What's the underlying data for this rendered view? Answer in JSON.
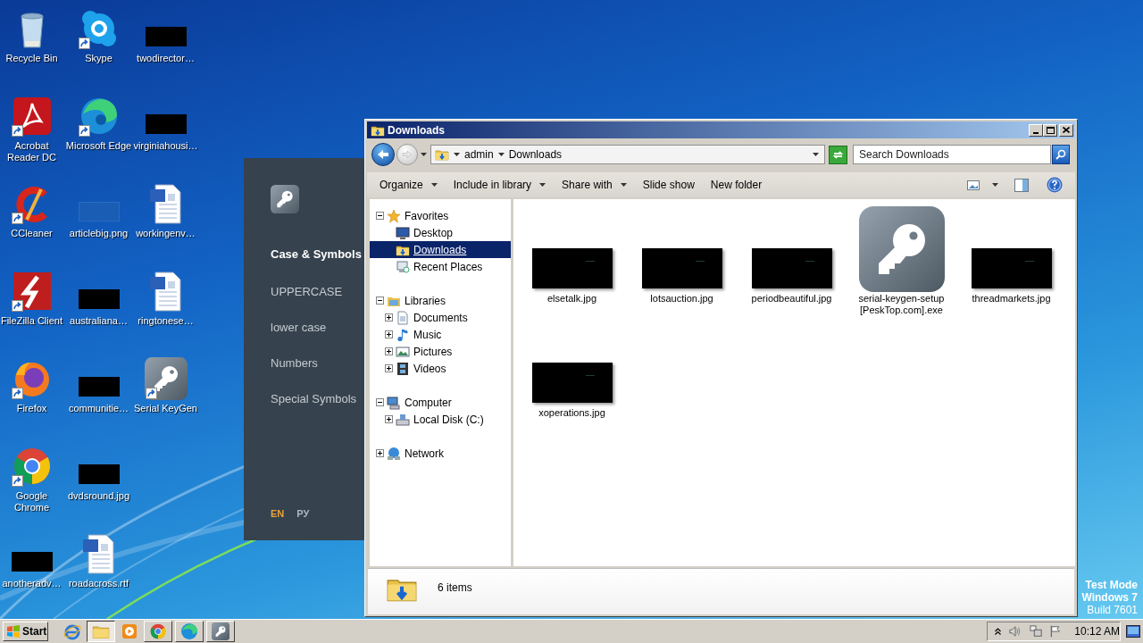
{
  "desktop_icons": [
    [
      {
        "label": "Recycle Bin",
        "kind": "recycle",
        "shortcut": false
      },
      {
        "label": "Skype",
        "kind": "chat",
        "shortcut": true
      },
      {
        "label": "twodirector…",
        "kind": "thumbnail",
        "shortcut": false
      }
    ],
    [
      {
        "label": "Acrobat Reader DC",
        "kind": "pdf",
        "shortcut": true
      },
      {
        "label": "Microsoft Edge",
        "kind": "edge",
        "shortcut": true
      },
      {
        "label": "virginiahousi…",
        "kind": "thumbnail",
        "shortcut": false
      }
    ],
    [
      {
        "label": "CCleaner",
        "kind": "cleaner",
        "shortcut": true
      },
      {
        "label": "articlebig.png",
        "kind": "blank",
        "shortcut": false
      },
      {
        "label": "workingenv…",
        "kind": "word",
        "shortcut": false
      }
    ],
    [
      {
        "label": "FileZilla Client",
        "kind": "ftp",
        "shortcut": true
      },
      {
        "label": "australiana…",
        "kind": "thumbnail",
        "shortcut": false
      },
      {
        "label": "ringtonese…",
        "kind": "word",
        "shortcut": false
      }
    ],
    [
      {
        "label": "Firefox",
        "kind": "fox",
        "shortcut": true
      },
      {
        "label": "communitie…",
        "kind": "thumbnail",
        "shortcut": false
      },
      {
        "label": "Serial KeyGen",
        "kind": "key",
        "shortcut": true
      }
    ],
    [
      {
        "label": "Google Chrome",
        "kind": "chrome",
        "shortcut": true
      },
      {
        "label": "dvdsround.jpg",
        "kind": "thumbnail",
        "shortcut": false
      }
    ],
    [
      {
        "label": "anotheradv…",
        "kind": "thumbnail",
        "shortcut": false
      },
      {
        "label": "roadacross.rtf",
        "kind": "word",
        "shortcut": false
      }
    ]
  ],
  "keygen_panel": {
    "heading": "Case & Symbols",
    "menu": [
      {
        "label": "UPPERCASE"
      },
      {
        "label": "lower case"
      },
      {
        "label": "Numbers"
      },
      {
        "label": "Special Symbols"
      }
    ],
    "languages": [
      {
        "label": "EN",
        "selected": true
      },
      {
        "label": "РУ",
        "selected": false
      }
    ]
  },
  "explorer": {
    "title": "Downloads",
    "address": [
      "admin",
      "Downloads"
    ],
    "search": {
      "placeholder": "Search Downloads"
    },
    "toolbar": [
      {
        "label": "Organize",
        "dropdown": true
      },
      {
        "label": "Include in library",
        "dropdown": true
      },
      {
        "label": "Share with",
        "dropdown": true
      },
      {
        "label": "Slide show",
        "dropdown": false
      },
      {
        "label": "New folder",
        "dropdown": false
      }
    ],
    "nav": [
      {
        "label": "Favorites",
        "kind": "star",
        "expanded": true,
        "selected": false,
        "children": [
          {
            "label": "Desktop",
            "kind": "desktop",
            "selected": false
          },
          {
            "label": "Downloads",
            "kind": "downloads",
            "selected": true
          },
          {
            "label": "Recent Places",
            "kind": "recent",
            "selected": false
          }
        ]
      },
      {
        "label": "Libraries",
        "kind": "library",
        "expanded": true,
        "selected": false,
        "children": [
          {
            "label": "Documents",
            "kind": "documents",
            "expanded": false,
            "selected": false
          },
          {
            "label": "Music",
            "kind": "music",
            "expanded": false,
            "selected": false
          },
          {
            "label": "Pictures",
            "kind": "pictures",
            "expanded": false,
            "selected": false
          },
          {
            "label": "Videos",
            "kind": "videos",
            "expanded": false,
            "selected": false
          }
        ]
      },
      {
        "label": "Computer",
        "kind": "computer",
        "expanded": true,
        "selected": false,
        "children": [
          {
            "label": "Local Disk (C:)",
            "kind": "disk",
            "expanded": false,
            "selected": false
          }
        ]
      },
      {
        "label": "Network",
        "kind": "network",
        "expanded": false,
        "selected": false
      }
    ],
    "files": [
      {
        "name": "elsetalk.jpg",
        "kind": "image"
      },
      {
        "name": "lotsauction.jpg",
        "kind": "image"
      },
      {
        "name": "periodbeautiful.jpg",
        "kind": "image"
      },
      {
        "name": "serial-keygen-setup [PeskTop.com].exe",
        "kind": "app"
      },
      {
        "name": "threadmarkets.jpg",
        "kind": "image"
      },
      {
        "name": "xoperations.jpg",
        "kind": "image"
      }
    ],
    "status": "6 items"
  },
  "taskbar": {
    "start": "Start",
    "buttons": [
      {
        "kind": "ie",
        "running": false,
        "active": false
      },
      {
        "kind": "folder",
        "running": true,
        "active": true
      },
      {
        "kind": "media",
        "running": false,
        "active": false
      },
      {
        "kind": "chrome",
        "running": true,
        "active": false
      },
      {
        "kind": "edge",
        "running": true,
        "active": false
      },
      {
        "kind": "key",
        "running": true,
        "active": false
      }
    ],
    "clock": "10:12 AM"
  },
  "test_mode": [
    {
      "text": "Test Mode",
      "bold": true
    },
    {
      "text": "Windows 7",
      "bold": true
    },
    {
      "text": "Build 7601",
      "bold": false
    }
  ]
}
